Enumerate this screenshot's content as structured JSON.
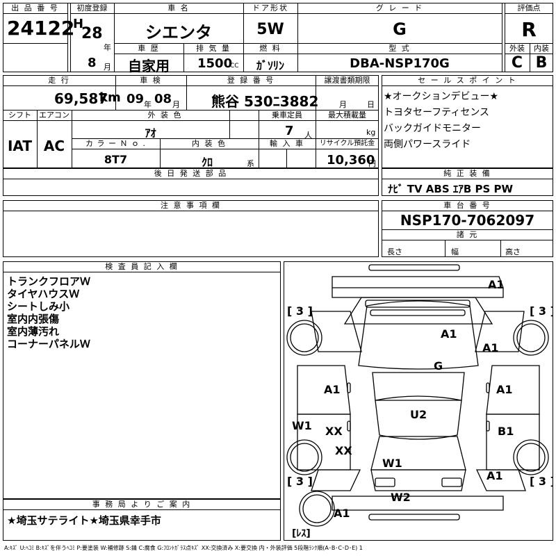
{
  "header": {
    "lot_label": "出 品 番 号",
    "lot_number": "24122",
    "first_reg_label": "初度登録",
    "era": "H",
    "year": "28",
    "year_unit": "年",
    "month": "8",
    "month_unit": "月",
    "car_name_label": "車 名",
    "car_name": "シエンタ",
    "door_label": "ドア形状",
    "door": "5W",
    "grade_label": "グ レ ー ド",
    "grade": "G",
    "score_label": "評価点",
    "score": "R",
    "history_label": "車 歴",
    "history": "自家用",
    "displacement_label": "排 気 量",
    "displacement": "1500",
    "cc": "CC",
    "fuel_label": "燃 料",
    "fuel": "ｶﾞｿﾘﾝ",
    "model_label": "型 式",
    "model": "DBA-NSP170G",
    "ext_label": "外装",
    "ext_grade": "C",
    "int_label": "内装",
    "int_grade": "B"
  },
  "details": {
    "mileage_label": "走 行",
    "mileage": "69,587",
    "mileage_unit": "km",
    "inspection_label": "車 検",
    "insp_year": "09",
    "insp_year_unit": "年",
    "insp_month": "08",
    "insp_month_unit": "月",
    "plate_label": "登 録 番 号",
    "plate": "熊谷 530ﾆ3882",
    "transfer_label": "譲渡書類期限",
    "transfer_month": "月",
    "transfer_day": "日",
    "shift_label": "シフト",
    "shift": "IAT",
    "ac_label": "エアコン",
    "ac": "AC",
    "ext_color_label": "外 装 色",
    "ext_color": "ｱｵ",
    "capacity_label": "乗車定員",
    "capacity": "7",
    "capacity_unit": "人",
    "max_load_label": "最大積載量",
    "max_load_unit": "kg",
    "color_no_label": "カ ラ ー Ｎ ｏ .",
    "color_no": "8T7",
    "int_color_label": "内 装 色",
    "int_color": "ｸﾛ",
    "int_color_suffix": "系",
    "import_label": "輸 入 車",
    "recycle_label": "リサイクル預託金",
    "recycle": "10,360",
    "recycle_unit": "円",
    "later_parts_label": "後 日 発 送 部 品"
  },
  "sales_points": {
    "label": "セ ー ル ス ポ イ ン ト",
    "items": [
      "★オークションデビュー★",
      "トヨタセーフティセンス",
      "バックガイドモニター",
      "両側パワースライド"
    ]
  },
  "equipment": {
    "label": "純 正 装 備",
    "items": "ﾅﾋﾞ  TV  ABS ｴｱB PS PW"
  },
  "notes_label": "注 意 事 項 欄",
  "chassis": {
    "label": "車 台 番 号",
    "number": "NSP170-7062097"
  },
  "dims": {
    "label": "諸 元",
    "length": "長さ",
    "width": "幅",
    "height": "高さ"
  },
  "inspector": {
    "label": "検 査 員 記 入 欄",
    "notes": [
      "トランクフロアＷ",
      "タイヤハウスＷ",
      "シートしみ小",
      "室内内張傷",
      "室内薄汚れ",
      "コーナーパネルＷ"
    ]
  },
  "office": {
    "label": "事 務 局 よ り ご 案 内",
    "text": "★埼玉サテライト★埼玉県幸手市"
  },
  "legend": "A:ｷｽﾞ U:ﾍｺﾐ B:ｷｽﾞを伴うﾍｺﾐ P:要塗装 W:補修跡 S:錆 C:腐食 G:ﾌﾛﾝﾄｶﾞﾗｽ点ｷｽﾞ XX:交換済み X:要交換 内・外装評価 5段階ﾗﾝｸ順(A･B･C･D･E) 1",
  "diagram": {
    "tire_tl": "[ 3 ]",
    "tire_tr": "[ 3 ]",
    "tire_bl": "[ 3 ]",
    "tire_br": "[ 3 ]",
    "spare": "[ﾚｽ]",
    "marks": [
      "A1",
      "A1",
      "A1",
      "G",
      "A1",
      "A1",
      "W1",
      "XX",
      "U2",
      "XX",
      "B1",
      "W1",
      "A1",
      "W2",
      "A1"
    ]
  }
}
